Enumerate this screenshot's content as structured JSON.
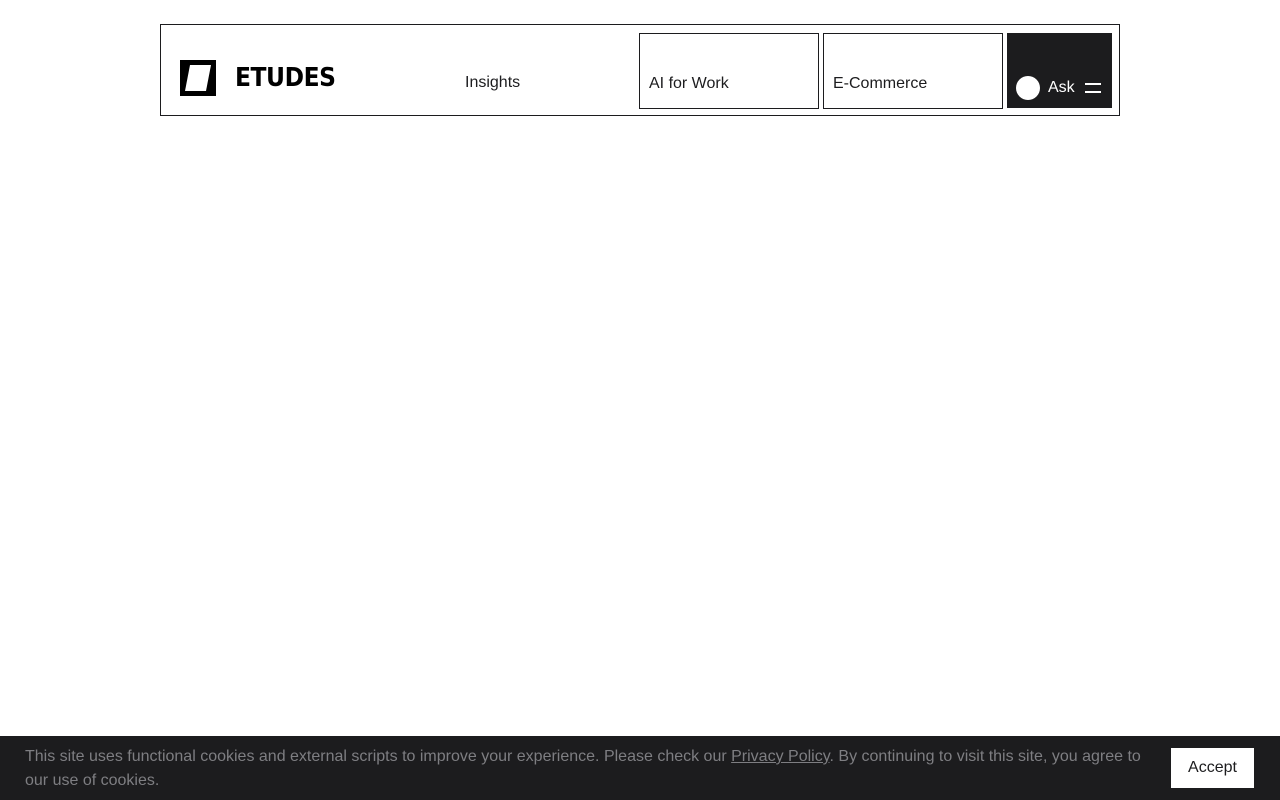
{
  "header": {
    "logo_text": "ETUDES",
    "nav": {
      "insights": "Insights",
      "ai_for_work": "AI for Work",
      "ecommerce": "E-Commerce"
    },
    "ask_label": "Ask"
  },
  "cookie_banner": {
    "text_before_link": "This site uses functional cookies and external scripts to improve your experience. Please check our ",
    "link_text": "Privacy Policy",
    "text_after_link": ". By continuing to visit this site, you agree to our use of cookies.",
    "accept_label": "Accept"
  },
  "colors": {
    "dark": "#1c1c1e",
    "background": "#ffffff",
    "muted_text": "#7e7e82"
  },
  "icons": {
    "logo": "etudes-logo-icon",
    "ask": "ask-dot-icon",
    "menu": "hamburger-menu-icon"
  }
}
